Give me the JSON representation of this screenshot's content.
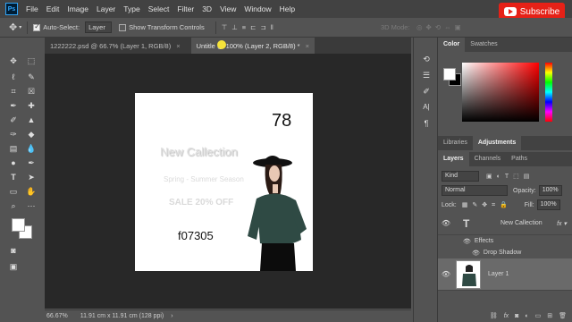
{
  "menubar": {
    "app_icon": "Ps",
    "items": [
      "File",
      "Edit",
      "Image",
      "Layer",
      "Type",
      "Select",
      "Filter",
      "3D",
      "View",
      "Window",
      "Help"
    ],
    "subscribe_label": "Subscribe"
  },
  "options": {
    "auto_select_label": "Auto-Select:",
    "auto_select_value": "Layer",
    "transform_label": "Show Transform Controls",
    "mode_label": "3D Mode:"
  },
  "tabs": [
    {
      "label": "1222222.psd @ 66.7% (Layer 1, RGB/8)",
      "close": "×"
    },
    {
      "label": "Untitle    @ 100% (Layer 2, RGB/8) *",
      "close": "×"
    }
  ],
  "document": {
    "number": "78",
    "headline": "New Callection",
    "subline": "Spring - Summer Season",
    "sale": "SALE 20% OFF",
    "code": "f07305"
  },
  "status": {
    "zoom": "66.67%",
    "size": "11.91 cm x 11.91 cm (128 ppi)"
  },
  "panels": {
    "color_tabs": [
      "Color",
      "Swatches"
    ],
    "adjust_tabs": [
      "Libraries",
      "Adjustments"
    ],
    "layers_tabs": [
      "Layers",
      "Channels",
      "Paths"
    ],
    "kind": "Kind",
    "blend_mode": "Normal",
    "opacity_label": "Opacity:",
    "opacity_value": "100%",
    "lock_label": "Lock:",
    "fill_label": "Fill:",
    "fill_value": "100%",
    "layers": [
      {
        "name": "New Callection",
        "type": "text"
      },
      {
        "name": "Effects",
        "type": "effects"
      },
      {
        "name": "Drop Shadow",
        "type": "effect"
      },
      {
        "name": "Layer 1",
        "type": "image"
      }
    ],
    "footer_icons": [
      "link-icon",
      "fx-icon",
      "mask-icon",
      "adjustment-icon",
      "folder-icon",
      "new-layer-icon",
      "trash-icon"
    ]
  }
}
